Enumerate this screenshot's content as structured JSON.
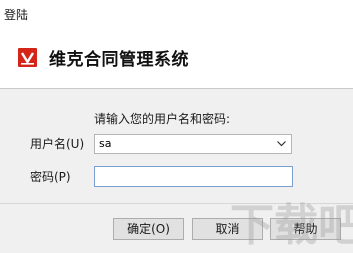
{
  "window": {
    "title": "登陆"
  },
  "banner": {
    "app_name": "维克合同管理系统",
    "logo_icon": "app-logo-icon",
    "logo_color": "#d42518"
  },
  "form": {
    "prompt": "请输入您的用户名和密码:",
    "username_label": "用户名(U)",
    "username_value": "sa",
    "password_label": "密码(P)",
    "password_value": ""
  },
  "buttons": {
    "ok": "确定(O)",
    "cancel": "取消",
    "help": "帮助"
  },
  "watermark": {
    "text": "下载吧"
  }
}
